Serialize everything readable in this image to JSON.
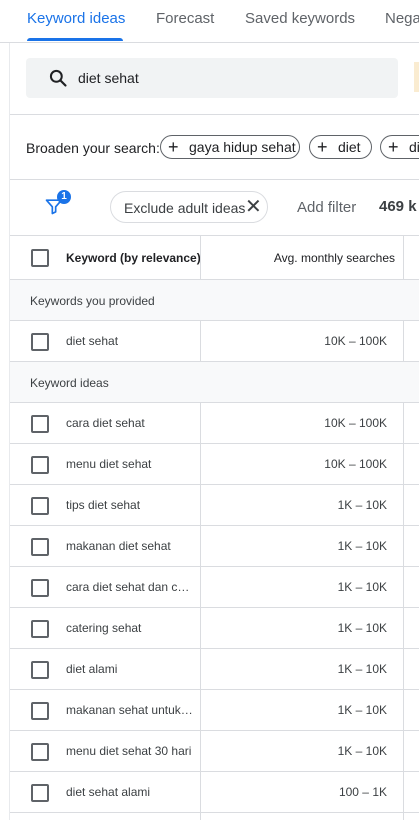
{
  "tabs": [
    {
      "label": "Keyword ideas",
      "active": true
    },
    {
      "label": "Forecast",
      "active": false
    },
    {
      "label": "Saved keywords",
      "active": false
    },
    {
      "label": "Nega",
      "active": false
    }
  ],
  "search": {
    "value": "diet sehat"
  },
  "broaden": {
    "label": "Broaden your search:",
    "chips": [
      "gaya hidup sehat",
      "diet",
      "di"
    ]
  },
  "filters": {
    "badge_count": "1",
    "exclude_chip": "Exclude adult ideas",
    "add_filter": "Add filter",
    "result_count": "469 k"
  },
  "table": {
    "header_keyword": "Keyword (by relevance)",
    "header_avg": "Avg. monthly searches",
    "sections": [
      {
        "title": "Keywords you provided",
        "rows": [
          {
            "keyword": "diet sehat",
            "volume": "10K – 100K"
          }
        ]
      },
      {
        "title": "Keyword ideas",
        "rows": [
          {
            "keyword": "cara diet sehat",
            "volume": "10K – 100K"
          },
          {
            "keyword": "menu diet sehat",
            "volume": "10K – 100K"
          },
          {
            "keyword": "tips diet sehat",
            "volume": "1K – 10K"
          },
          {
            "keyword": "makanan diet sehat",
            "volume": "1K – 10K"
          },
          {
            "keyword": "cara diet sehat dan cepat",
            "volume": "1K – 10K"
          },
          {
            "keyword": "catering sehat",
            "volume": "1K – 10K"
          },
          {
            "keyword": "diet alami",
            "volume": "1K – 10K"
          },
          {
            "keyword": "makanan sehat untuk diet",
            "volume": "1K – 10K"
          },
          {
            "keyword": "menu diet sehat 30 hari",
            "volume": "1K – 10K"
          },
          {
            "keyword": "diet sehat alami",
            "volume": "100 – 1K"
          }
        ]
      }
    ]
  },
  "colors": {
    "accent": "#1a73e8",
    "divider": "#dadce0",
    "section_bg": "#f8f9fa"
  },
  "icons": [
    "search-icon",
    "plus-icon",
    "filter-icon",
    "close-icon",
    "checkbox-icon"
  ]
}
